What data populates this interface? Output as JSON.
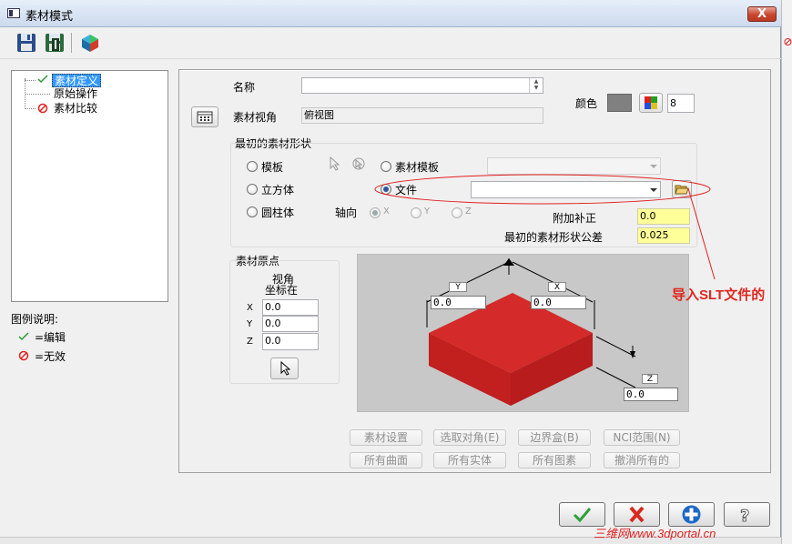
{
  "window": {
    "title": "素材模式",
    "close_label": "X"
  },
  "toolbar": {
    "icons": [
      "save-icon",
      "save-as-icon",
      "stock-solid-icon"
    ]
  },
  "tree": {
    "items": [
      {
        "label": "素材定义",
        "status": "edit",
        "selected": true
      },
      {
        "label": "原始操作",
        "status": "none",
        "selected": false
      },
      {
        "label": "素材比较",
        "status": "invalid",
        "selected": false
      }
    ]
  },
  "legend": {
    "title": "图例说明:",
    "items": [
      {
        "icon": "check-icon",
        "label": "=编辑"
      },
      {
        "icon": "invalid-icon",
        "label": "=无效"
      }
    ]
  },
  "main": {
    "name_label": "名称",
    "name_value": "",
    "view_label": "素材视角",
    "view_value": "俯视图",
    "color_label": "颜色",
    "color_value": "8",
    "color_swatch": "#808080",
    "shape_group_label": "最初的素材形状",
    "shape_options": {
      "template": "模板",
      "cube": "立方体",
      "cylinder": "圆柱体",
      "stock_template": "素材模板",
      "file": "文件"
    },
    "selected_shape": "file",
    "axis_label": "轴向",
    "axes": [
      "X",
      "Y",
      "Z"
    ],
    "selected_axis": "X",
    "offset_label": "附加补正",
    "offset_value": "0.0",
    "tolerance_label": "最初的素材形状公差",
    "tolerance_value": "0.025",
    "origin_group_label": "素材原点",
    "origin_view_line1": "视角",
    "origin_view_line2": "坐标在",
    "origin_x_label": "X",
    "origin_y_label": "Y",
    "origin_z_label": "Z",
    "origin_x": "0.0",
    "origin_y": "0.0",
    "origin_z": "0.0"
  },
  "preview": {
    "y_tag": "Y",
    "x_tag": "X",
    "z_tag": "Z",
    "y_value": "0.0",
    "x_value": "0.0",
    "z_value": "0.0",
    "block_color": "#d42a2a"
  },
  "bottom_buttons_row1": [
    "素材设置",
    "选取对角(E)",
    "边界盒(B)",
    "NCI范围(N)"
  ],
  "bottom_buttons_row2": [
    "所有曲面",
    "所有实体",
    "所有图素",
    "撤消所有的"
  ],
  "dialog_buttons": [
    "ok-icon",
    "cancel-icon",
    "add-icon",
    "help-icon"
  ],
  "annotation": {
    "text": "导入SLT文件的",
    "color": "#e0261f"
  },
  "watermark": "三维网www.3dportal.cn"
}
